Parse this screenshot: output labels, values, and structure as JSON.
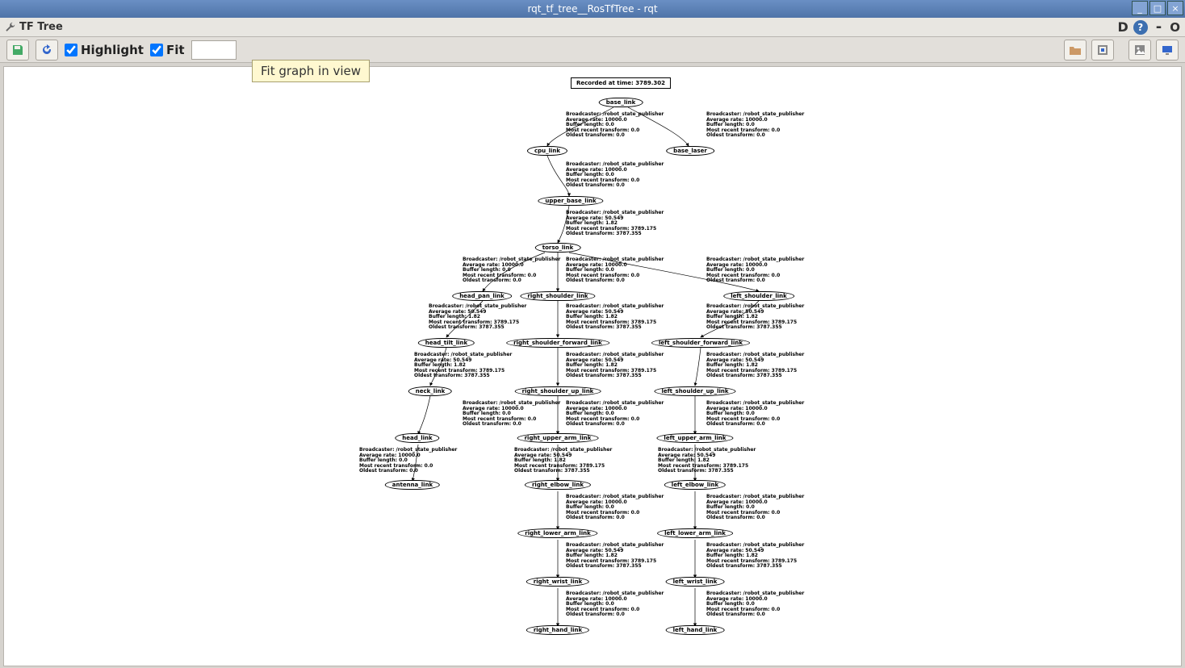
{
  "window": {
    "title": "rqt_tf_tree__RosTfTree - rqt"
  },
  "panel": {
    "title": "TF Tree",
    "d_label": "D",
    "minus": "-",
    "circle": "O"
  },
  "toolbar": {
    "highlight_label": "Highlight",
    "fit_label": "Fit",
    "tooltip": "Fit graph in view"
  },
  "graph": {
    "recorded_label": "Recorded at time: 3789.302",
    "nodes": {
      "base_link": "base_link",
      "cpu_link": "cpu_link",
      "base_laser": "base_laser",
      "upper_base_link": "upper_base_link",
      "torso_link": "torso_link",
      "head_pan_link": "head_pan_link",
      "right_shoulder_link": "right_shoulder_link",
      "left_shoulder_link": "left_shoulder_link",
      "head_tilt_link": "head_tilt_link",
      "right_shoulder_forward_link": "right_shoulder_forward_link",
      "left_shoulder_forward_link": "left_shoulder_forward_link",
      "neck_link": "neck_link",
      "right_shoulder_up_link": "right_shoulder_up_link",
      "left_shoulder_up_link": "left_shoulder_up_link",
      "head_link": "head_link",
      "right_upper_arm_link": "right_upper_arm_link",
      "left_upper_arm_link": "left_upper_arm_link",
      "antenna_link": "antenna_link",
      "right_elbow_link": "right_elbow_link",
      "left_elbow_link": "left_elbow_link",
      "right_lower_arm_link": "right_lower_arm_link",
      "left_lower_arm_link": "left_lower_arm_link",
      "right_wrist_link": "right_wrist_link",
      "left_wrist_link": "left_wrist_link",
      "right_hand_link": "right_hand_link",
      "left_hand_link": "left_hand_link"
    },
    "edge_text_fast": "Broadcaster: /robot_state_publisher\nAverage rate: 10000.0\nBuffer length: 0.0\nMost recent transform: 0.0\nOldest transform: 0.0",
    "edge_text_slow": "Broadcaster: /robot_state_publisher\nAverage rate: 50.549\nBuffer length: 1.82\nMost recent transform: 3789.175\nOldest transform: 3787.355"
  }
}
